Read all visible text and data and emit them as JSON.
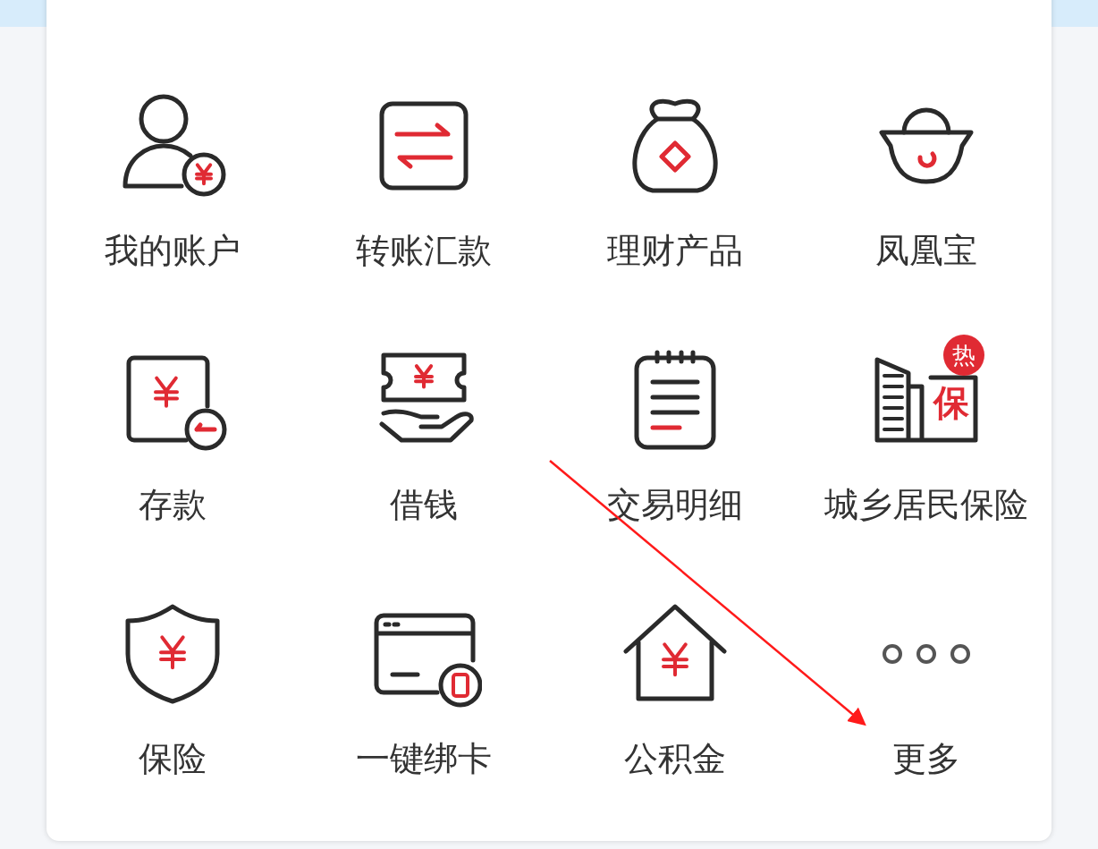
{
  "items": [
    {
      "kind": "account",
      "label": "我的账户"
    },
    {
      "kind": "transfer",
      "label": "转账汇款"
    },
    {
      "kind": "wealth",
      "label": "理财产品"
    },
    {
      "kind": "ingot",
      "label": "凤凰宝"
    },
    {
      "kind": "deposit",
      "label": "存款"
    },
    {
      "kind": "loan",
      "label": "借钱"
    },
    {
      "kind": "detail",
      "label": "交易明细"
    },
    {
      "kind": "insure_building",
      "label": "城乡居民保险",
      "icon_text": "保",
      "badge": "热"
    },
    {
      "kind": "shield",
      "label": "保险"
    },
    {
      "kind": "card",
      "label": "一键绑卡"
    },
    {
      "kind": "house",
      "label": "公积金"
    },
    {
      "kind": "more",
      "label": "更多"
    }
  ]
}
